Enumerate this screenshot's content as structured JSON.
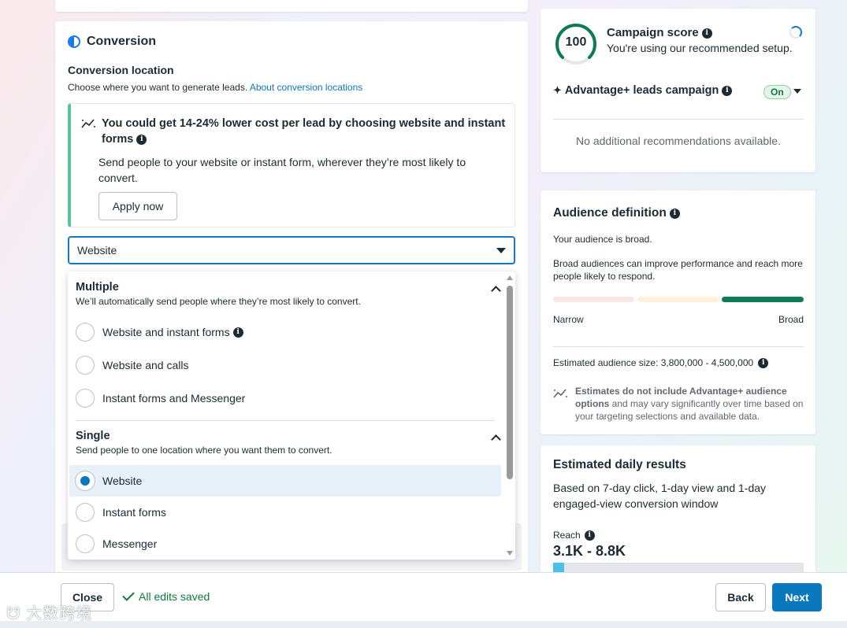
{
  "conversion": {
    "section_title": "Conversion",
    "location_title": "Conversion location",
    "location_desc": "Choose where you want to generate leads.",
    "location_link": "About conversion locations",
    "promo": {
      "title": "You could get 14-24% lower cost per lead by choosing website and instant forms",
      "body": "Send people to your website or instant form, wherever they’re most likely to convert.",
      "apply_label": "Apply now"
    },
    "select_value": "Website"
  },
  "dropdown": {
    "multiple": {
      "title": "Multiple",
      "desc": "We’ll automatically send people where they’re most likely to convert.",
      "options": [
        "Website and instant forms",
        "Website and calls",
        "Instant forms and Messenger"
      ]
    },
    "single": {
      "title": "Single",
      "desc": "Send people to one location where you want them to convert.",
      "options": [
        "Website",
        "Instant forms",
        "Messenger"
      ],
      "selected": "Website"
    }
  },
  "score": {
    "value": "100",
    "title": "Campaign score",
    "subtitle": "You're using our recommended setup.",
    "advantage_label": "Advantage+ leads campaign",
    "toggle": "On",
    "no_recs": "No additional recommendations available."
  },
  "audience": {
    "title": "Audience definition",
    "broad_text": "Your audience is broad.",
    "broad_desc": "Broad audiences can improve performance and reach more people likely to respond.",
    "narrow_label": "Narrow",
    "broad_label": "Broad",
    "level": "broad",
    "size_text": "Estimated audience size: 3,800,000 - 4,500,000",
    "note_bold": "Estimates do not include Advantage+ audience options",
    "note_rest": " and may vary significantly over time based on your targeting selections and available data."
  },
  "daily": {
    "title": "Estimated daily results",
    "desc": "Based on 7-day click, 1-day view and 1-day engaged-view conversion window",
    "reach_label": "Reach",
    "reach_value": "3.1K - 8.8K",
    "reach_fill_fraction": 0.045
  },
  "footer": {
    "close_label": "Close",
    "saved_label": "All edits saved",
    "back_label": "Back",
    "next_label": "Next"
  },
  "watermark": "大数跨境",
  "colors": {
    "primary": "#0a78be",
    "success": "#0e7a3c",
    "promo_accent": "#59c4a0",
    "reach_fill": "#4cc0e8"
  }
}
